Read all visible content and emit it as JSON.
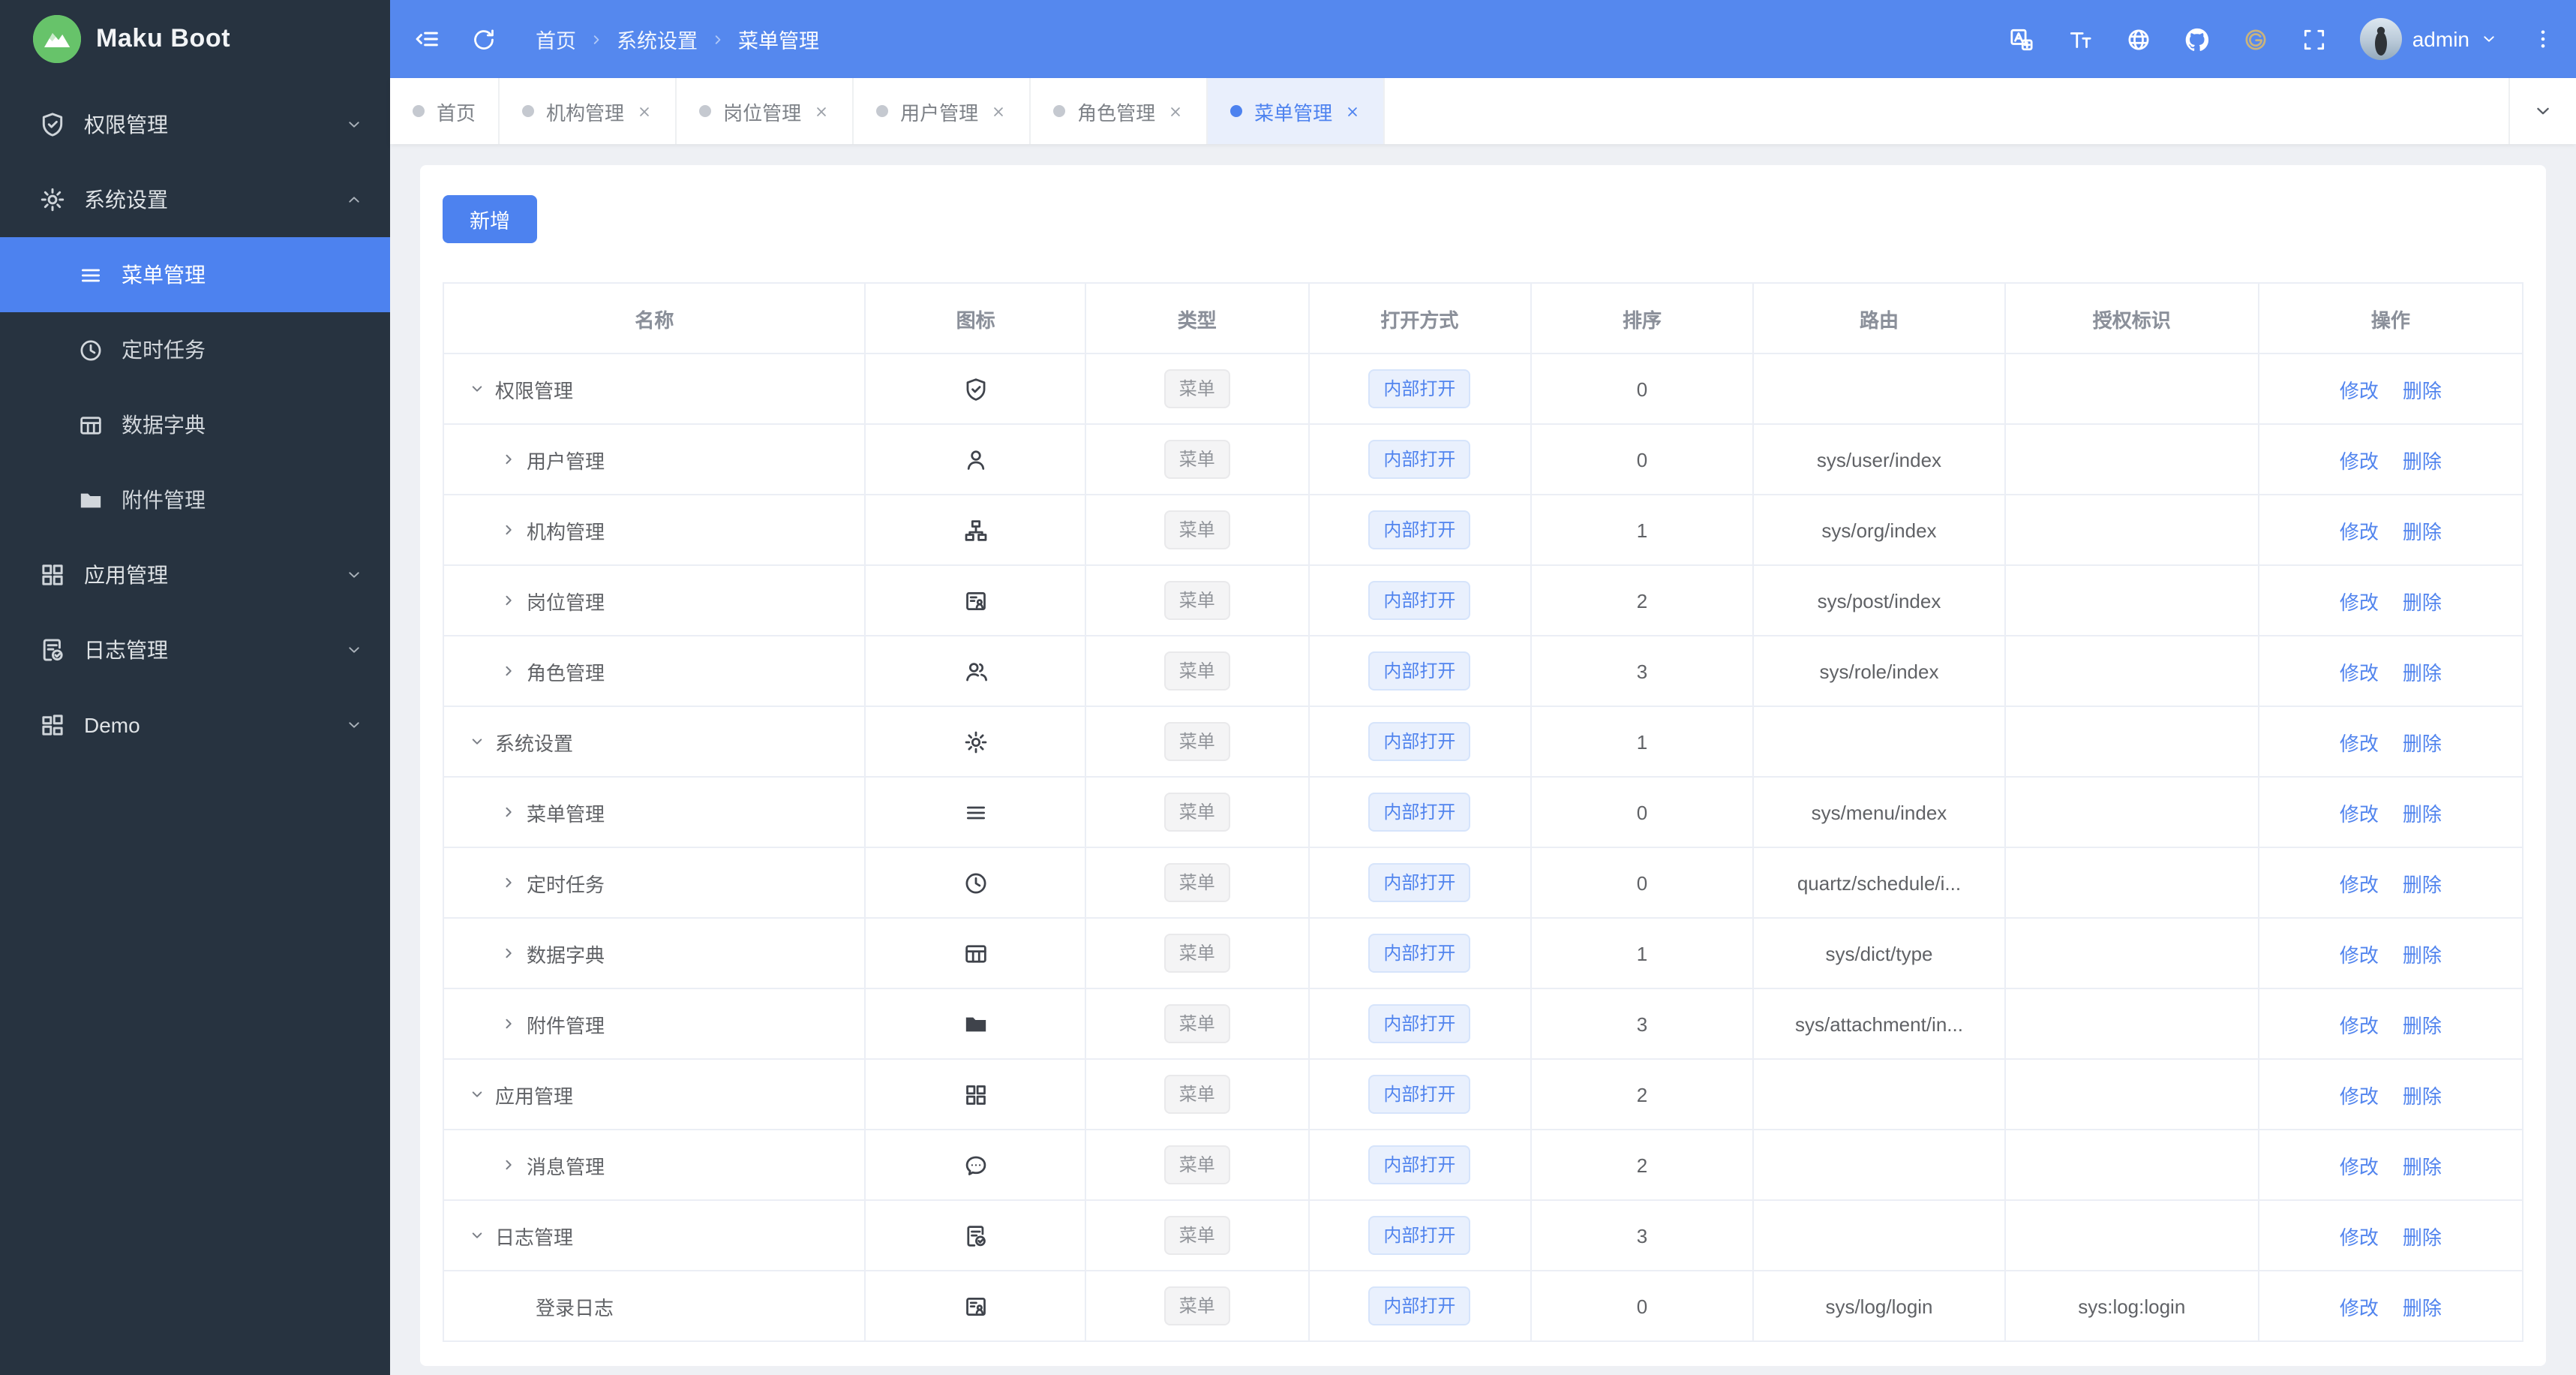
{
  "app": {
    "logo_title": "Maku Boot"
  },
  "colors": {
    "primary": "#4d82ef",
    "header_bg": "#5588ee",
    "sidebar_bg": "#273340",
    "sidebar_active_bg": "#4d82ef",
    "tab_active_bg": "#e9effc",
    "content_bg": "#eef0f4",
    "tag_type_bg": "#f4f4f5",
    "tag_type_text": "#909399",
    "tag_open_bg": "#e9f0fd",
    "tag_open_text": "#5184ee",
    "logo_green": "#67c36a",
    "gitee_gold": "#c9b37e"
  },
  "header": {
    "breadcrumb": [
      "首页",
      "系统设置",
      "菜单管理"
    ],
    "username": "admin",
    "left_icons": [
      "collapse",
      "refresh"
    ],
    "right_icons": [
      "translate",
      "font-size",
      "globe",
      "github",
      "gitee",
      "fullscreen"
    ]
  },
  "sidebar": {
    "items": [
      {
        "label": "权限管理",
        "icon": "shield-check",
        "chevron": "down"
      },
      {
        "label": "系统设置",
        "icon": "gear",
        "chevron": "up",
        "expanded": true,
        "children": [
          {
            "label": "菜单管理",
            "icon": "menu-lines",
            "active": true
          },
          {
            "label": "定时任务",
            "icon": "clock"
          },
          {
            "label": "数据字典",
            "icon": "dict-table"
          },
          {
            "label": "附件管理",
            "icon": "folder"
          }
        ]
      },
      {
        "label": "应用管理",
        "icon": "app-grid",
        "chevron": "down"
      },
      {
        "label": "日志管理",
        "icon": "doc-check",
        "chevron": "down"
      },
      {
        "label": "Demo",
        "icon": "demo-grid",
        "chevron": "down"
      }
    ]
  },
  "tabs": {
    "items": [
      {
        "label": "首页",
        "closable": false,
        "active": false
      },
      {
        "label": "机构管理",
        "closable": true,
        "active": false
      },
      {
        "label": "岗位管理",
        "closable": true,
        "active": false
      },
      {
        "label": "用户管理",
        "closable": true,
        "active": false
      },
      {
        "label": "角色管理",
        "closable": true,
        "active": false
      },
      {
        "label": "菜单管理",
        "closable": true,
        "active": true
      }
    ]
  },
  "toolbar": {
    "add_label": "新增"
  },
  "table": {
    "columns": [
      "名称",
      "图标",
      "类型",
      "打开方式",
      "排序",
      "路由",
      "授权标识",
      "操作"
    ],
    "type_tag": "菜单",
    "open_tag": "内部打开",
    "actions": {
      "edit": "修改",
      "delete": "删除"
    },
    "rows": [
      {
        "name": "权限管理",
        "level": 0,
        "arrow": "down",
        "icon": "shield-check",
        "sort": "0",
        "route": "",
        "perm": ""
      },
      {
        "name": "用户管理",
        "level": 1,
        "arrow": "right",
        "icon": "user",
        "sort": "0",
        "route": "sys/user/index",
        "perm": ""
      },
      {
        "name": "机构管理",
        "level": 1,
        "arrow": "right",
        "icon": "org",
        "sort": "1",
        "route": "sys/org/index",
        "perm": ""
      },
      {
        "name": "岗位管理",
        "level": 1,
        "arrow": "right",
        "icon": "id-card",
        "sort": "2",
        "route": "sys/post/index",
        "perm": ""
      },
      {
        "name": "角色管理",
        "level": 1,
        "arrow": "right",
        "icon": "users",
        "sort": "3",
        "route": "sys/role/index",
        "perm": ""
      },
      {
        "name": "系统设置",
        "level": 0,
        "arrow": "down",
        "icon": "gear",
        "sort": "1",
        "route": "",
        "perm": ""
      },
      {
        "name": "菜单管理",
        "level": 1,
        "arrow": "right",
        "icon": "menu-lines",
        "sort": "0",
        "route": "sys/menu/index",
        "perm": ""
      },
      {
        "name": "定时任务",
        "level": 1,
        "arrow": "right",
        "icon": "clock",
        "sort": "0",
        "route": "quartz/schedule/i...",
        "perm": ""
      },
      {
        "name": "数据字典",
        "level": 1,
        "arrow": "right",
        "icon": "dict-table",
        "sort": "1",
        "route": "sys/dict/type",
        "perm": ""
      },
      {
        "name": "附件管理",
        "level": 1,
        "arrow": "right",
        "icon": "folder",
        "sort": "3",
        "route": "sys/attachment/in...",
        "perm": ""
      },
      {
        "name": "应用管理",
        "level": 0,
        "arrow": "down",
        "icon": "app-grid",
        "sort": "2",
        "route": "",
        "perm": ""
      },
      {
        "name": "消息管理",
        "level": 1,
        "arrow": "right",
        "icon": "message",
        "sort": "2",
        "route": "",
        "perm": ""
      },
      {
        "name": "日志管理",
        "level": 0,
        "arrow": "down",
        "icon": "doc-check",
        "sort": "3",
        "route": "",
        "perm": ""
      },
      {
        "name": "登录日志",
        "level": 1,
        "arrow": null,
        "icon": "id-card",
        "sort": "0",
        "route": "sys/log/login",
        "perm": "sys:log:login"
      }
    ]
  }
}
